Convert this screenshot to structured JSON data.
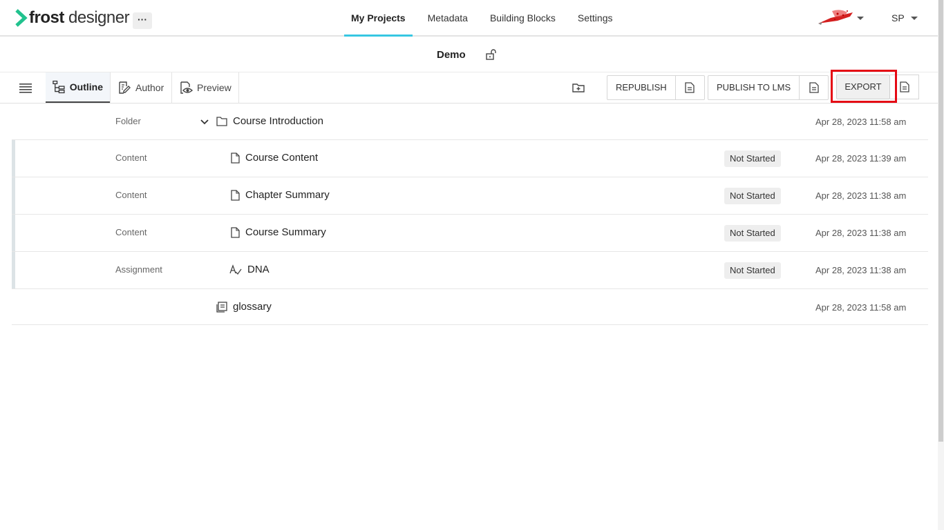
{
  "brand": {
    "bold": "frost",
    "light": " designer",
    "more": "···"
  },
  "nav": {
    "links": [
      "My Projects",
      "Metadata",
      "Building Blocks",
      "Settings"
    ],
    "user_initials": "SP"
  },
  "project": {
    "title": "Demo"
  },
  "toolbar": {
    "tabs": [
      "Outline",
      "Author",
      "Preview"
    ],
    "republish": "REPUBLISH",
    "publish_lms": "PUBLISH TO LMS",
    "export": "EXPORT"
  },
  "rows": [
    {
      "type": "Folder",
      "title": "Course Introduction",
      "status": "",
      "date": "Apr 28, 2023 11:58 am",
      "icon": "folder-icon"
    },
    {
      "type": "Content",
      "title": "Course Content",
      "status": "Not Started",
      "date": "Apr 28, 2023 11:39 am",
      "icon": "document-icon"
    },
    {
      "type": "Content",
      "title": "Chapter Summary",
      "status": "Not Started",
      "date": "Apr 28, 2023 11:38 am",
      "icon": "document-icon"
    },
    {
      "type": "Content",
      "title": "Course Summary",
      "status": "Not Started",
      "date": "Apr 28, 2023 11:38 am",
      "icon": "document-icon"
    },
    {
      "type": "Assignment",
      "title": "DNA",
      "status": "Not Started",
      "date": "Apr 28, 2023 11:38 am",
      "icon": "assignment-icon"
    },
    {
      "type": "",
      "title": "glossary",
      "status": "",
      "date": "Apr 28, 2023 11:58 am",
      "icon": "glossary-icon"
    }
  ],
  "colors": {
    "accent": "#36c7e2",
    "brand_green": "#21c28e",
    "highlight": "#e50914"
  }
}
